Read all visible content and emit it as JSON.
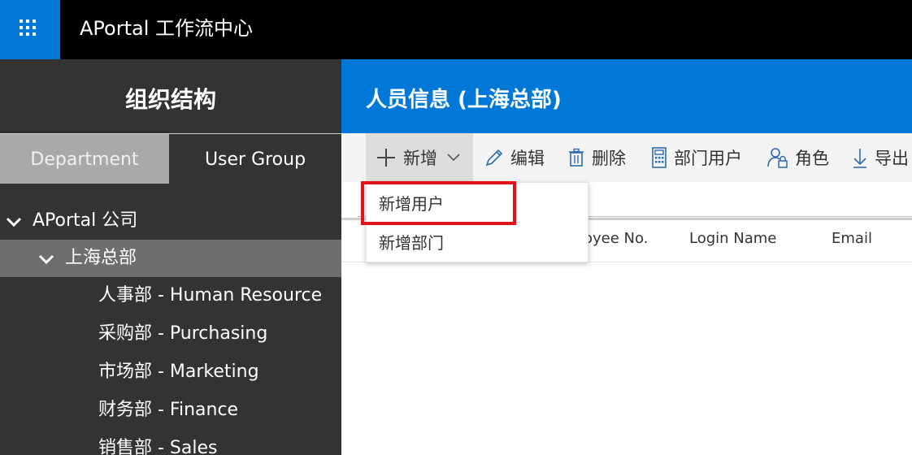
{
  "app": {
    "title": "APortal 工作流中心"
  },
  "sidebar": {
    "title": "组织结构",
    "tabs": [
      {
        "label": "Department"
      },
      {
        "label": "User Group"
      }
    ],
    "tree": [
      {
        "label": "APortal 公司"
      },
      {
        "label": "上海总部"
      },
      {
        "label": "人事部 - Human Resource"
      },
      {
        "label": "采购部 - Purchasing"
      },
      {
        "label": "市场部 - Marketing"
      },
      {
        "label": "财务部 - Finance"
      },
      {
        "label": "销售部 - Sales"
      }
    ]
  },
  "main": {
    "title": "人员信息 (上海总部)",
    "toolbar": {
      "new": "新增",
      "edit": "编辑",
      "delete": "删除",
      "dept_users": "部门用户",
      "role": "角色",
      "export": "导出"
    },
    "columns": [
      {
        "label": "oyee No."
      },
      {
        "label": "Login Name"
      },
      {
        "label": "Email"
      }
    ],
    "new_menu": [
      {
        "label": "新增用户"
      },
      {
        "label": "新增部门"
      }
    ]
  },
  "colors": {
    "accent": "#0078d7",
    "topbar": "#000000",
    "sidebar": "#333333",
    "highlight": "#e0121c"
  }
}
